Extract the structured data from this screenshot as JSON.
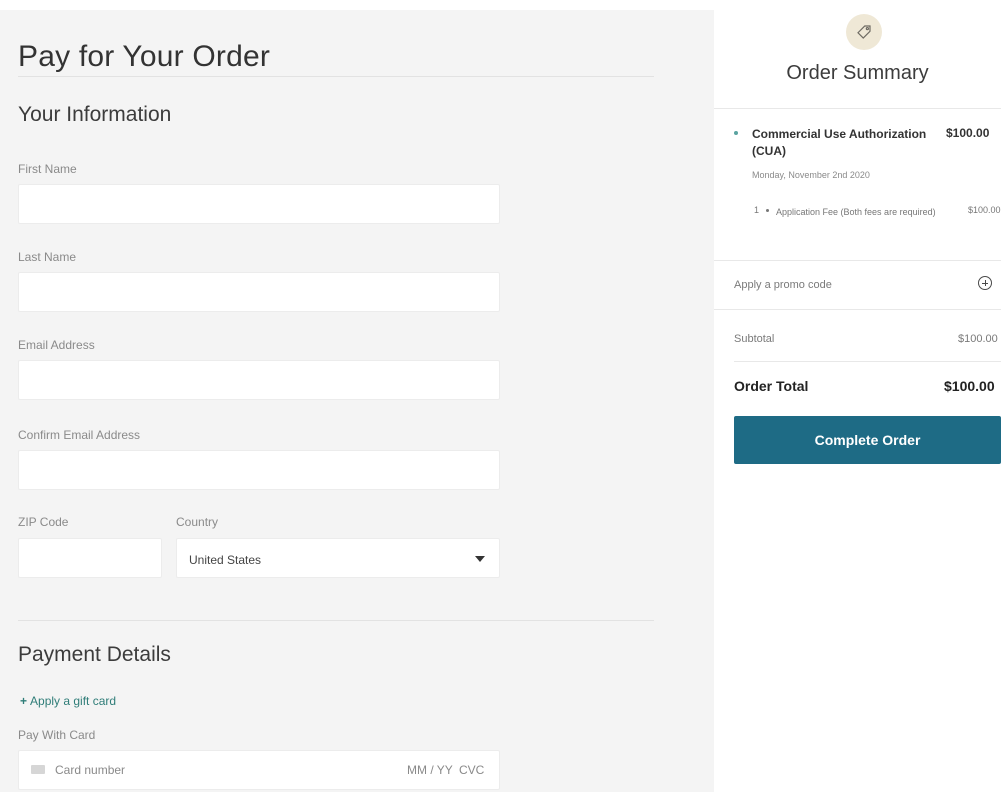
{
  "page": {
    "title": "Pay for Your Order"
  },
  "your_information": {
    "title": "Your Information",
    "first_name_label": "First Name",
    "first_name_value": "",
    "last_name_label": "Last Name",
    "last_name_value": "",
    "email_label": "Email Address",
    "email_value": "",
    "confirm_email_label": "Confirm Email Address",
    "confirm_email_value": "",
    "zip_label": "ZIP Code",
    "zip_value": "",
    "country_label": "Country",
    "country_value": "United States"
  },
  "payment": {
    "title": "Payment Details",
    "gift_card_plus": "+",
    "gift_card_link": "Apply a gift card",
    "pay_with_card_label": "Pay With Card",
    "card_number_placeholder": "Card number",
    "expiry_placeholder": "MM / YY",
    "cvc_placeholder": "CVC"
  },
  "summary": {
    "title": "Order Summary",
    "icon": "tag-icon",
    "item": {
      "name": "Commercial Use Authorization (CUA)",
      "price": "$100.00",
      "date": "Monday, November 2nd 2020",
      "fee_qty": "1",
      "fee_name": "Application Fee (Both fees are required)",
      "fee_price": "$100.00"
    },
    "promo_label": "Apply a promo code",
    "subtotal_label": "Subtotal",
    "subtotal_value": "$100.00",
    "total_label": "Order Total",
    "total_value": "$100.00",
    "complete_button": "Complete Order"
  },
  "colors": {
    "accent": "#1e6b85",
    "link": "#2f7d78",
    "background": "#f4f4f4"
  }
}
